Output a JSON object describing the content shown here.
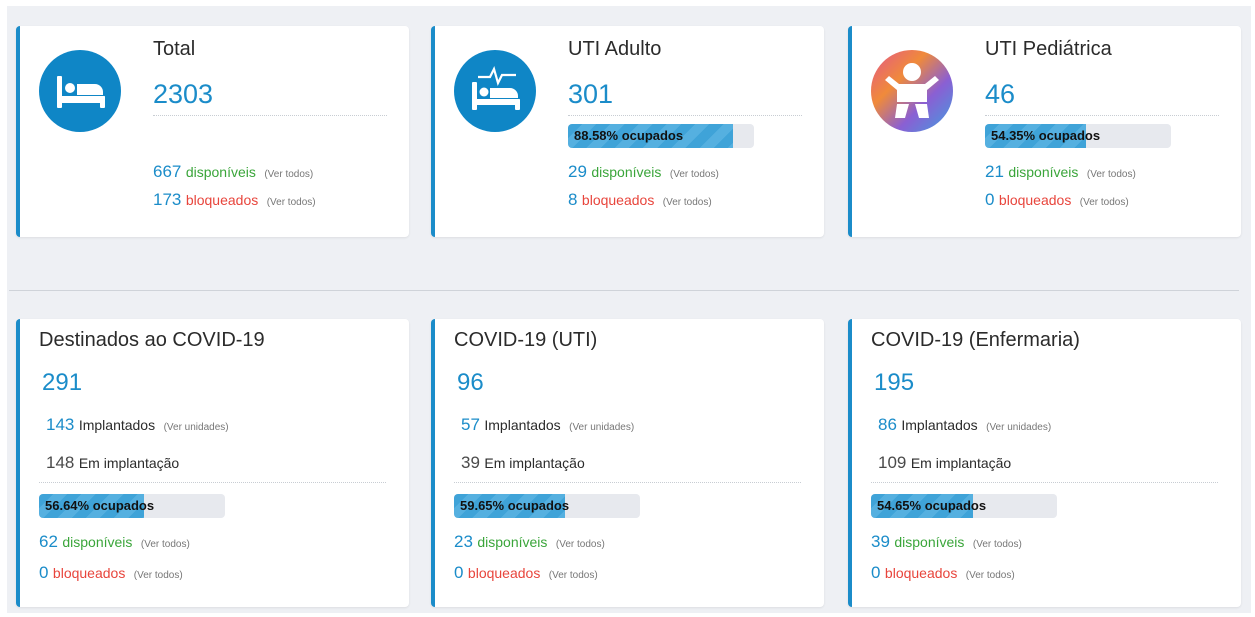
{
  "colors": {
    "accent": "#1b8cc9",
    "available": "#3aa53a",
    "blocked": "#e8453c"
  },
  "top_cards": [
    {
      "title": "Total",
      "icon": "bed-icon",
      "value": "2303",
      "available": "667",
      "available_label": "disponíveis",
      "blocked": "173",
      "blocked_label": "bloqueados",
      "link": "(Ver todos)"
    },
    {
      "title": "UTI Adulto",
      "icon": "icu-bed-icon",
      "value": "301",
      "occupancy": 88.58,
      "occupancy_label": "88.58% ocupados",
      "available": "29",
      "available_label": "disponíveis",
      "blocked": "8",
      "blocked_label": "bloqueados",
      "link": "(Ver todos)"
    },
    {
      "title": "UTI Pediátrica",
      "icon": "baby-icon",
      "value": "46",
      "occupancy": 54.35,
      "occupancy_label": "54.35% ocupados",
      "available": "21",
      "available_label": "disponíveis",
      "blocked": "0",
      "blocked_label": "bloqueados",
      "link": "(Ver todos)"
    }
  ],
  "bottom_cards": [
    {
      "title": "Destinados ao COVID-19",
      "value": "291",
      "implanted": "143",
      "implanted_label": "Implantados",
      "units_link": "(Ver unidades)",
      "in_progress": "148",
      "in_progress_label": "Em implantação",
      "occupancy": 56.64,
      "occupancy_label": "56.64% ocupados",
      "available": "62",
      "available_label": "disponíveis",
      "blocked": "0",
      "blocked_label": "bloqueados",
      "link": "(Ver todos)"
    },
    {
      "title": "COVID-19 (UTI)",
      "value": "96",
      "implanted": "57",
      "implanted_label": "Implantados",
      "units_link": "(Ver unidades)",
      "in_progress": "39",
      "in_progress_label": "Em implantação",
      "occupancy": 59.65,
      "occupancy_label": "59.65% ocupados",
      "available": "23",
      "available_label": "disponíveis",
      "blocked": "0",
      "blocked_label": "bloqueados",
      "link": "(Ver todos)"
    },
    {
      "title": "COVID-19 (Enfermaria)",
      "value": "195",
      "implanted": "86",
      "implanted_label": "Implantados",
      "units_link": "(Ver unidades)",
      "in_progress": "109",
      "in_progress_label": "Em implantação",
      "occupancy": 54.65,
      "occupancy_label": "54.65% ocupados",
      "available": "39",
      "available_label": "disponíveis",
      "blocked": "0",
      "blocked_label": "bloqueados",
      "link": "(Ver todos)"
    }
  ]
}
